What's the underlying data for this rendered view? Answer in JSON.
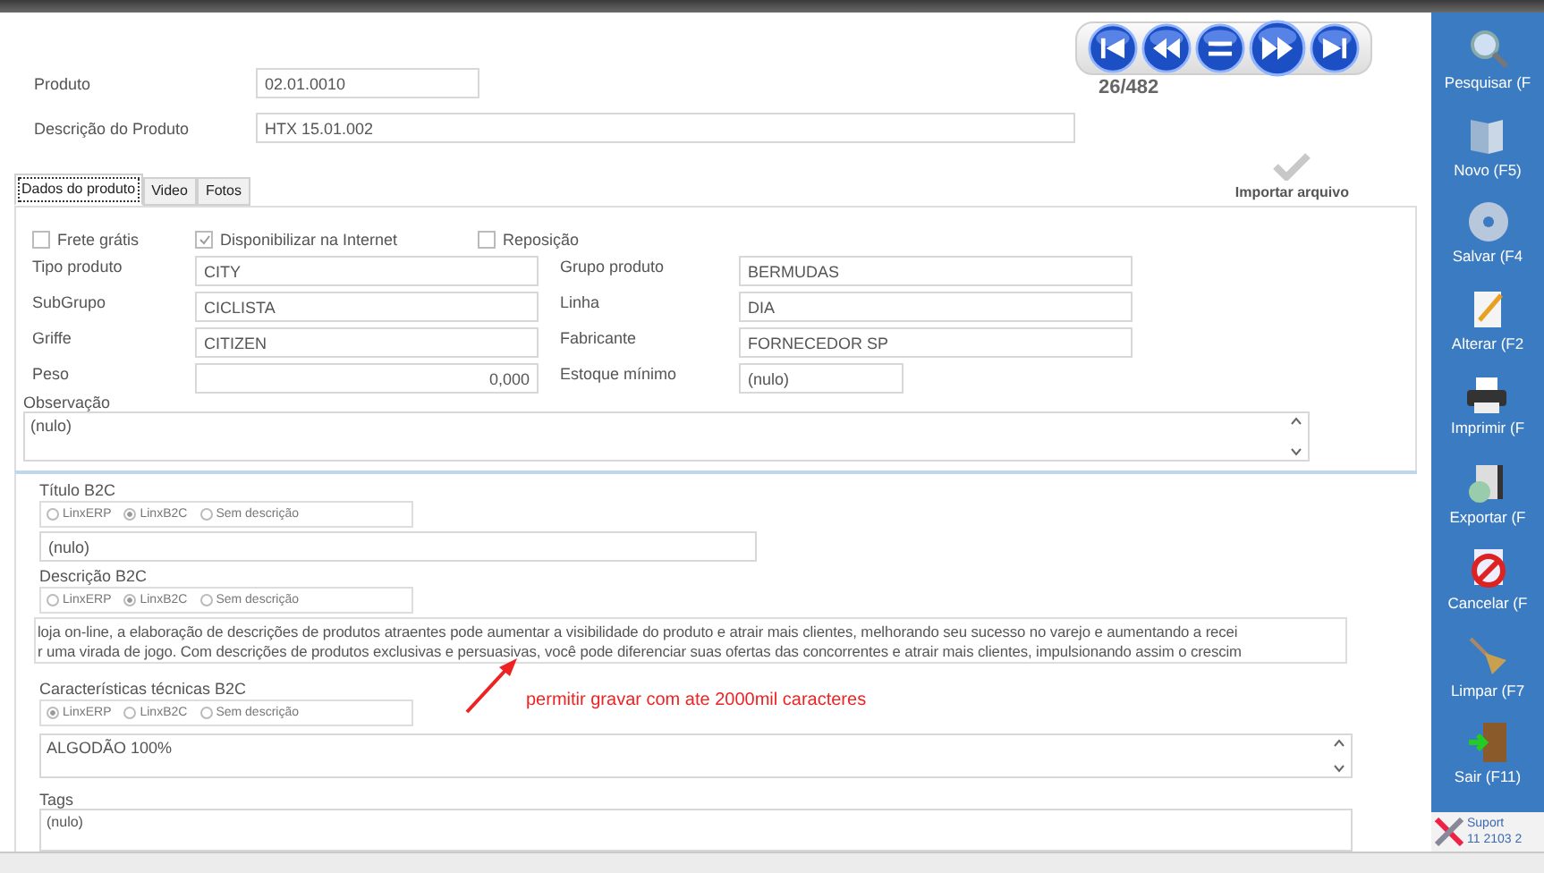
{
  "header": {
    "fields": [
      {
        "label": "Produto",
        "value": "02.01.0010",
        "kind": "short"
      },
      {
        "label": "Descrição do Produto",
        "value": "HTX 15.01.002",
        "kind": "long"
      }
    ],
    "navigator": {
      "buttons": [
        {
          "kind": "first"
        },
        {
          "kind": "previous"
        },
        {
          "kind": "list"
        },
        {
          "kind": "next"
        },
        {
          "kind": "last"
        }
      ],
      "counter": "26/482"
    },
    "import_label": "Importar arquivo"
  },
  "tabs": [
    {
      "label": "Dados do produto",
      "selected": true
    },
    {
      "label": "Video",
      "selected": false
    },
    {
      "label": "Fotos",
      "selected": false
    }
  ],
  "options": [
    {
      "label": "Frete grátis",
      "checked": false
    },
    {
      "label": "Disponibilizar na Internet",
      "checked": true
    },
    {
      "label": "Reposição",
      "checked": false
    }
  ],
  "rows": [
    {
      "cells": [
        {
          "label": "Tipo produto",
          "value": "CITY",
          "kind": "text"
        },
        {
          "label": "Grupo produto",
          "value": "BERMUDAS",
          "kind": "text"
        }
      ]
    },
    {
      "cells": [
        {
          "label": "SubGrupo",
          "value": "CICLISTA",
          "kind": "text"
        },
        {
          "label": "Linha",
          "value": "DIA",
          "kind": "text"
        }
      ]
    },
    {
      "cells": [
        {
          "label": "Griffe",
          "value": "CITIZEN",
          "kind": "text"
        },
        {
          "label": "Fabricante",
          "value": "FORNECEDOR SP",
          "kind": "text"
        }
      ]
    },
    {
      "cells": [
        {
          "label": "Peso",
          "value": "0,000",
          "kind": "number"
        },
        {
          "label": "Estoque mínimo",
          "value": "(nulo)",
          "kind": "short"
        }
      ]
    }
  ],
  "observation": {
    "label": "Observação",
    "value": "(nulo)"
  },
  "b2c": [
    {
      "label": "Título B2C",
      "kind": "line",
      "options": [
        {
          "label": "LinxERP",
          "selected": false
        },
        {
          "label": "LinxB2C",
          "selected": true
        },
        {
          "label": "Sem descrição",
          "selected": false
        }
      ],
      "lines": [
        "(nulo)"
      ]
    },
    {
      "label": "Descrição B2C",
      "kind": "multi",
      "options": [
        {
          "label": "LinxERP",
          "selected": false
        },
        {
          "label": "LinxB2C",
          "selected": true
        },
        {
          "label": "Sem descrição",
          "selected": false
        }
      ],
      "lines": [
        "loja on-line, a elaboração de descrições de produtos atraentes pode aumentar a visibilidade do produto e atrair mais clientes, melhorando seu sucesso no varejo e aumentando a recei",
        "r uma virada de jogo. Com descrições de produtos exclusivas e persuasivas, você pode diferenciar suas ofertas das concorrentes e atrair mais clientes, impulsionando assim o crescim"
      ]
    },
    {
      "label": "Características técnicas B2C",
      "kind": "scroll",
      "options": [
        {
          "label": "LinxERP",
          "selected": true
        },
        {
          "label": "LinxB2C",
          "selected": false
        },
        {
          "label": "Sem descrição",
          "selected": false
        }
      ],
      "lines": [
        "ALGODÃO 100%"
      ]
    }
  ],
  "annotation": "permitir gravar com ate 2000mil caracteres",
  "tags": {
    "label": "Tags",
    "value": "(nulo)"
  },
  "sidebar": {
    "actions": [
      {
        "label": "Pesquisar (F",
        "kind": "search"
      },
      {
        "label": "Novo (F5)",
        "kind": "new"
      },
      {
        "label": "Salvar (F4",
        "kind": "save"
      },
      {
        "label": "Alterar (F2",
        "kind": "edit"
      },
      {
        "label": "Imprimir (F",
        "kind": "print"
      },
      {
        "label": "Exportar (F",
        "kind": "export"
      },
      {
        "label": "Cancelar (F",
        "kind": "cancel"
      },
      {
        "label": "Limpar (F7",
        "kind": "clear"
      },
      {
        "label": "Sair (F11)",
        "kind": "exit"
      }
    ],
    "support": [
      "Suport",
      "11 2103 2"
    ]
  }
}
